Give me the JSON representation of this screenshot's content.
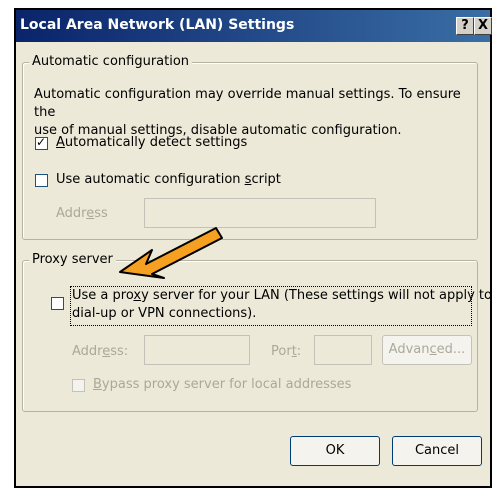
{
  "window": {
    "title": "Local Area Network (LAN) Settings",
    "help_label": "?",
    "close_label": "X"
  },
  "auto_config": {
    "legend": "Automatic configuration",
    "description_line1": "Automatic configuration may override manual settings.  To ensure the",
    "description_line2": "use of manual settings, disable automatic configuration.",
    "detect_settings": {
      "label_prefix": "",
      "label_mnemonic": "A",
      "label_rest": "utomatically detect settings",
      "checked": true
    },
    "use_script": {
      "label_prefix": "Use automatic configuration ",
      "label_mnemonic": "s",
      "label_rest": "cript",
      "checked": false
    },
    "address_label_prefix": "Addr",
    "address_label_mnemonic": "e",
    "address_label_rest": "ss",
    "address_value": ""
  },
  "proxy": {
    "legend": "Proxy server",
    "use_proxy": {
      "line1_prefix": "Use a pro",
      "line1_mnemonic": "x",
      "line1_rest": "y server for your LAN (These settings will not apply to",
      "line2": "dial-up or VPN connections).",
      "checked": false
    },
    "address_label_prefix": "Addr",
    "address_label_mnemonic": "e",
    "address_label_rest": "ss:",
    "address_value": "",
    "port_label_prefix": "Por",
    "port_label_mnemonic": "t",
    "port_label_rest": ":",
    "port_value": "",
    "advanced_label_prefix": "Advan",
    "advanced_label_mnemonic": "c",
    "advanced_label_rest": "ed...",
    "bypass_label_prefix": "",
    "bypass_label_mnemonic": "B",
    "bypass_label_rest": "ypass proxy server for local addresses",
    "bypass_checked": false
  },
  "footer": {
    "ok_label": "OK",
    "cancel_label": "Cancel"
  },
  "colors": {
    "arrow": "#f5a020",
    "title_start": "#0a246a",
    "title_end": "#3a6ea5"
  }
}
